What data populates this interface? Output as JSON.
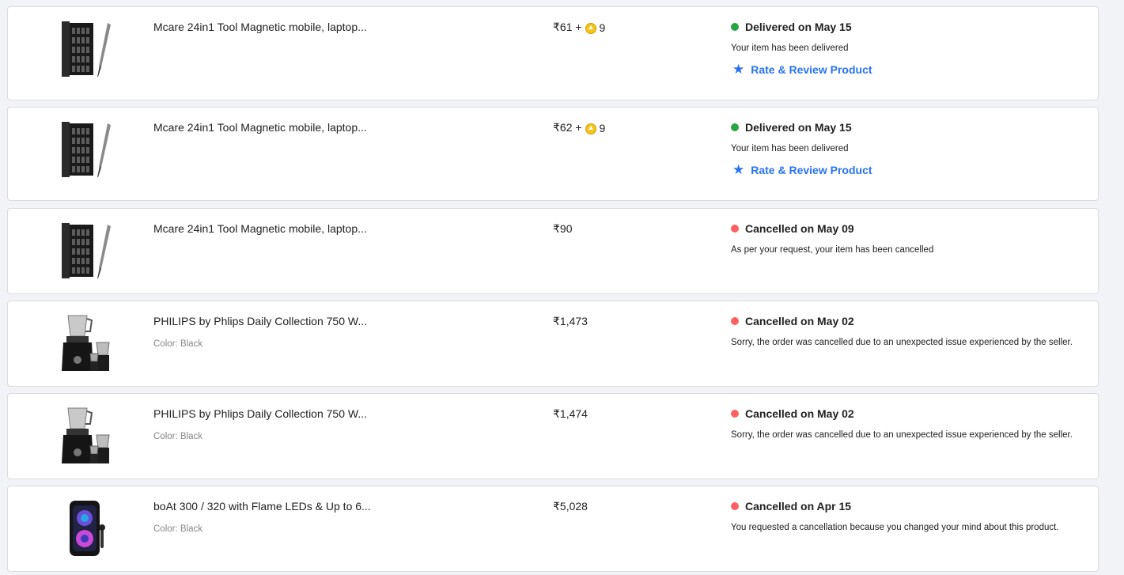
{
  "colors": {
    "delivered": "#26a541",
    "cancelled": "#ff6161",
    "link": "#2874f0"
  },
  "orders": [
    {
      "title": "Mcare 24in1 Tool Magnetic mobile, laptop...",
      "price": "₹61 +",
      "coins": "9",
      "status": "Delivered on May 15",
      "status_type": "delivered",
      "message": "Your item has been delivered",
      "action": "Rate & Review Product",
      "thumbnail": "screwdriver-kit-image"
    },
    {
      "title": "Mcare 24in1 Tool Magnetic mobile, laptop...",
      "price": "₹62 +",
      "coins": "9",
      "status": "Delivered on May 15",
      "status_type": "delivered",
      "message": "Your item has been delivered",
      "action": "Rate & Review Product",
      "thumbnail": "screwdriver-kit-image"
    },
    {
      "title": "Mcare 24in1 Tool Magnetic mobile, laptop...",
      "price": "₹90",
      "status": "Cancelled on May 09",
      "status_type": "cancelled",
      "message": "As per your request, your item has been cancelled",
      "thumbnail": "screwdriver-kit-image"
    },
    {
      "title": "PHILIPS by Phlips Daily Collection 750 W...",
      "variant": "Color: Black",
      "price": "₹1,473",
      "status": "Cancelled on May 02",
      "status_type": "cancelled",
      "message": "Sorry, the order was cancelled due to an unexpected issue experienced by the seller.",
      "thumbnail": "mixer-grinder-image"
    },
    {
      "title": "PHILIPS by Phlips Daily Collection 750 W...",
      "variant": "Color: Black",
      "price": "₹1,474",
      "status": "Cancelled on May 02",
      "status_type": "cancelled",
      "message": "Sorry, the order was cancelled due to an unexpected issue experienced by the seller.",
      "thumbnail": "mixer-grinder-image"
    },
    {
      "title": "boAt 300 / 320 with Flame LEDs & Up to 6...",
      "variant": "Color: Black",
      "price": "₹5,028",
      "status": "Cancelled on Apr 15",
      "status_type": "cancelled",
      "message": "You requested a cancellation because you changed your mind about this product.",
      "thumbnail": "party-speaker-image"
    }
  ]
}
